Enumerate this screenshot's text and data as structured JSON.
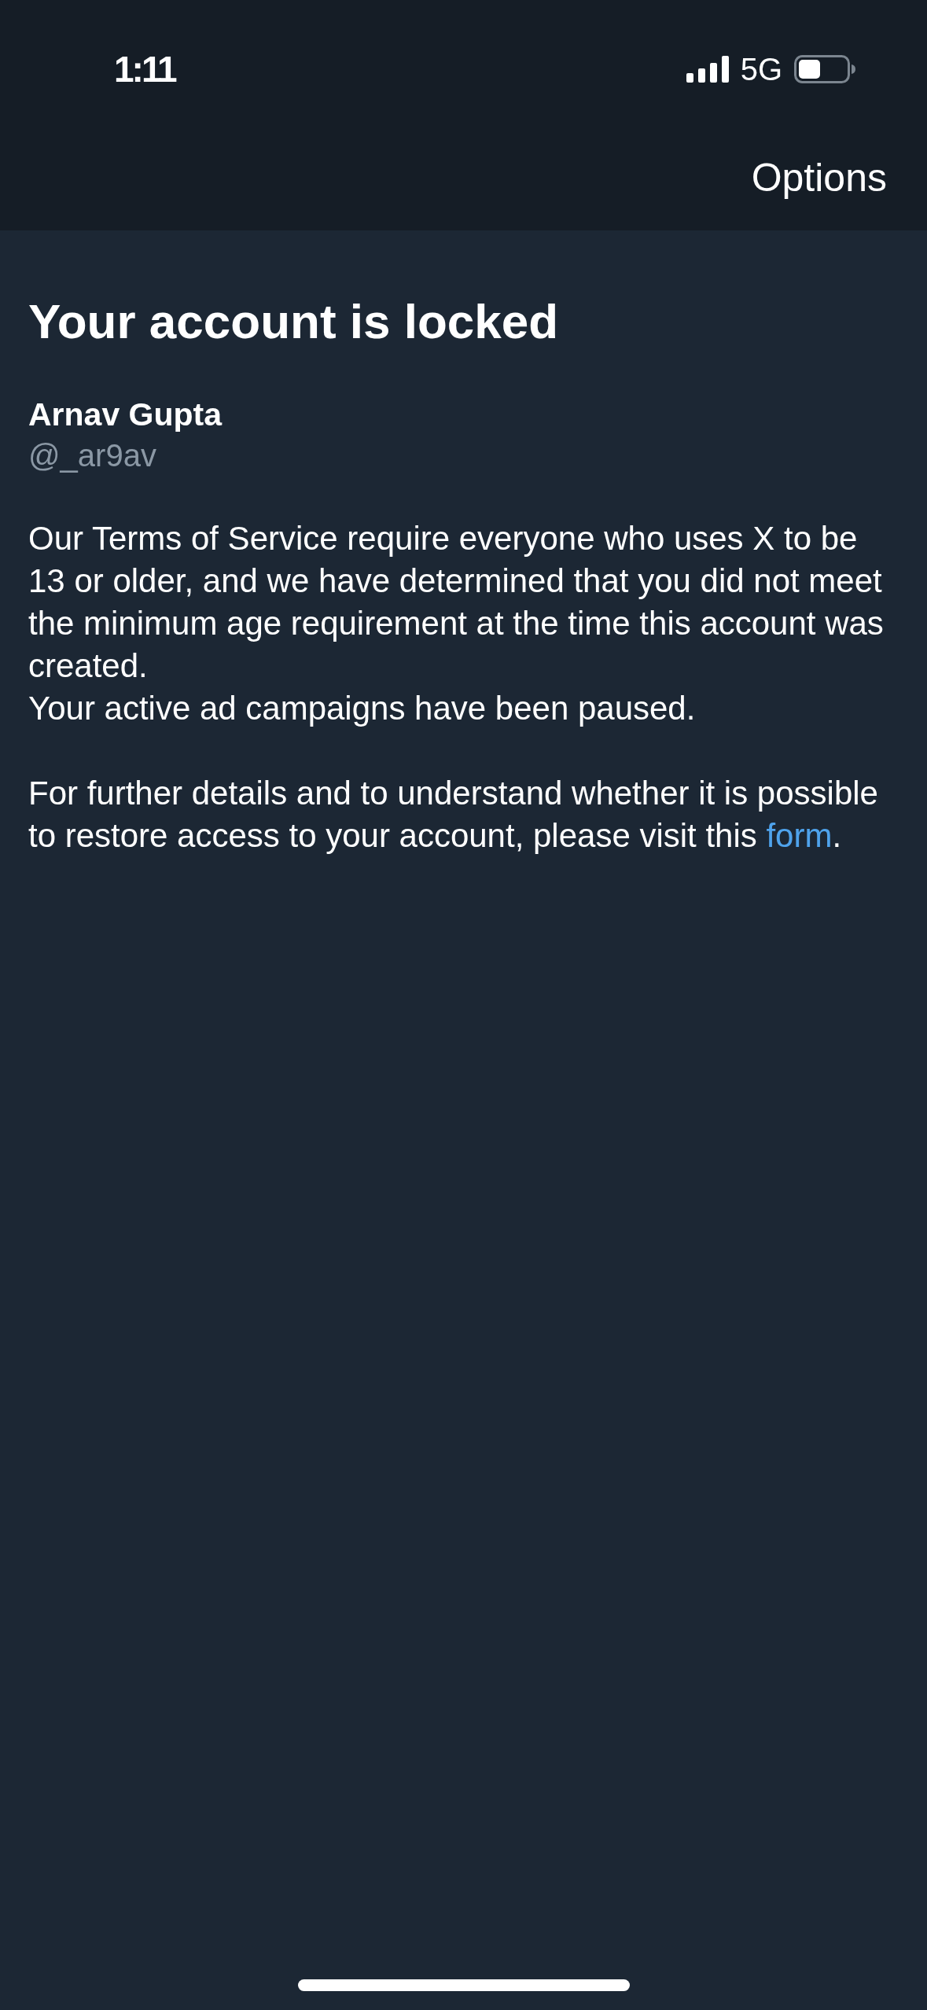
{
  "status_bar": {
    "time": "1:11",
    "network": "5G"
  },
  "nav_bar": {
    "action": "Options"
  },
  "title": "Your account is locked",
  "account": {
    "name": "Arnav Gupta",
    "handle": "@_ar9av"
  },
  "message": [
    {
      "text": "Our Terms of Service require everyone who uses X to be 13 or older, and we have determined that you did not meet the minimum age requirement at the time this account was created."
    },
    {
      "text": "Your active ad campaigns have been paused."
    }
  ],
  "help": {
    "text": "For further details and to understand whether it is possible to restore access to your account, please visit this ",
    "link": "form",
    "end": "."
  }
}
